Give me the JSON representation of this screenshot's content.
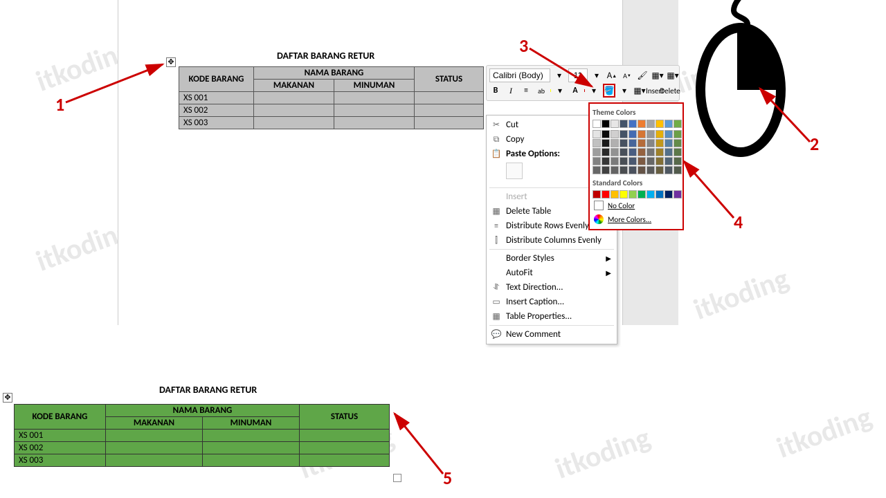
{
  "watermark_text": "itkoding",
  "title": "DAFTAR BARANG RETUR",
  "table": {
    "headers": {
      "kode": "KODE BARANG",
      "nama": "NAMA BARANG",
      "status": "STATUS",
      "makanan": "MAKANAN",
      "minuman": "MINUMAN"
    },
    "rows": [
      "XS 001",
      "XS 002",
      "XS 003"
    ]
  },
  "mini_toolbar": {
    "font": "Calibri (Body)",
    "size": "11",
    "bold": "B",
    "italic": "I",
    "insert": "Insert",
    "delete": "Delete"
  },
  "context_menu": {
    "cut": "Cut",
    "copy": "Copy",
    "paste_options": "Paste Options:",
    "insert": "Insert",
    "delete_table": "Delete Table",
    "dist_rows": "Distribute Rows Evenly",
    "dist_cols": "Distribute Columns Evenly",
    "border_styles": "Border Styles",
    "autofit": "AutoFit",
    "text_direction": "Text Direction...",
    "insert_caption": "Insert Caption...",
    "table_props": "Table Properties...",
    "new_comment": "New Comment"
  },
  "color_panel": {
    "theme_colors": "Theme Colors",
    "standard_colors": "Standard Colors",
    "no_color": "No Color",
    "more_colors": "More Colors...",
    "theme_row1": [
      "#ffffff",
      "#000000",
      "#e7e6e6",
      "#44546a",
      "#4472c4",
      "#ed7d31",
      "#a5a5a5",
      "#ffc000",
      "#5b9bd5",
      "#70ad47"
    ],
    "standard_row": [
      "#c00000",
      "#ff0000",
      "#ffc000",
      "#ffff00",
      "#92d050",
      "#00b050",
      "#00b0f0",
      "#0070c0",
      "#002060",
      "#7030a0"
    ]
  },
  "annotations": {
    "a1": "1",
    "a2": "2",
    "a3": "3",
    "a4": "4",
    "a5": "5"
  }
}
